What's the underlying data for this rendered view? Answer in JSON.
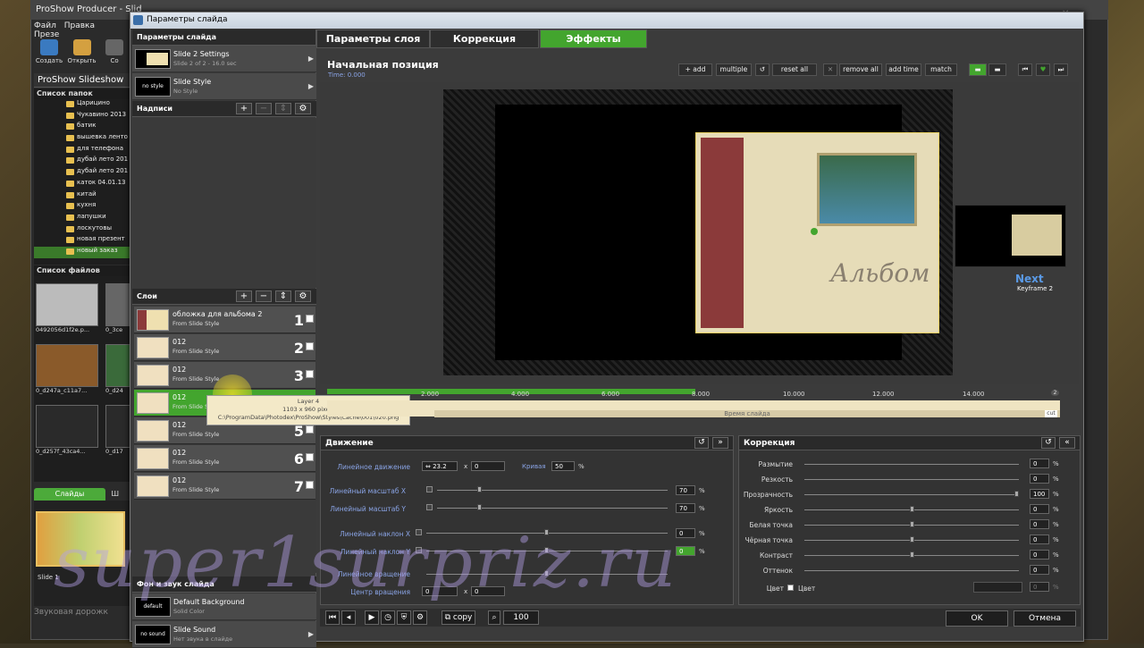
{
  "background_app": {
    "title": "ProShow Producer - Slid",
    "menu": [
      "Файл",
      "Правка",
      "Презе"
    ],
    "toolbar": [
      "Создать",
      "Открыть",
      "Со"
    ],
    "project": "ProShow Slideshow",
    "folders_header": "Список папок",
    "folders": [
      "Царицино",
      "Чукавино 2013",
      "батик",
      "вышевка ленто",
      "для телефона",
      "дубай лето 201",
      "дубай лето 201",
      "каток 04.01.13",
      "китай",
      "кухня",
      "лапушки",
      "лоскутовы",
      "новая презент",
      "новый заказ"
    ],
    "files_header": "Список файлов",
    "files": [
      "0492056d1f2e.p...",
      "0_3ce",
      "0_d247a_c11a7...",
      "0_d24",
      "0_d257f_43ca4...",
      "0_d17"
    ],
    "tab_slides": "Слайды",
    "tab_other": "Ш",
    "slide_label": "Slide 1",
    "audio_label": "Звуковая дорожк"
  },
  "dialog": {
    "title": "Параметры слайда",
    "left": {
      "header": "Параметры слайда",
      "slide_settings": {
        "title": "Slide 2 Settings",
        "sub": "Slide 2 of 2 - 16.0 sec"
      },
      "slide_style": {
        "thumb": "no style",
        "title": "Slide Style",
        "sub": "No Style"
      },
      "captions_header": "Надписи",
      "layers_header": "Слои",
      "layers": [
        {
          "name": "обложка для альбома 2",
          "sub": "From Slide Style",
          "num": "1"
        },
        {
          "name": "012",
          "sub": "From Slide Style",
          "num": "2"
        },
        {
          "name": "012",
          "sub": "From Slide Style",
          "num": "3"
        },
        {
          "name": "012",
          "sub": "From Slide Style",
          "num": "4"
        },
        {
          "name": "012",
          "sub": "From Slide Style",
          "num": "5"
        },
        {
          "name": "012",
          "sub": "From Slide Style",
          "num": "6"
        },
        {
          "name": "012",
          "sub": "From Slide Style",
          "num": "7"
        }
      ],
      "tooltip": {
        "line1": "Layer 4",
        "line2": "1103 x 960 pixels",
        "line3": "C:\\ProgramData\\Photodex\\ProShow\\Styles\\Cache\\001\\020.png"
      },
      "bg_sound_header": "Фон и звук слайда",
      "bg": {
        "thumb": "default",
        "title": "Default Background",
        "sub": "Solid Color"
      },
      "sound": {
        "thumb": "no sound",
        "title": "Slide Sound",
        "sub": "Нет звука в слайде"
      }
    },
    "tabs": [
      "Параметры слоя",
      "Коррекция",
      "Эффекты"
    ],
    "position_title": "Начальная позиция",
    "position_time": "Time: 0.000",
    "toolbar": {
      "add": "add",
      "multiple": "multiple",
      "reset_all": "reset all",
      "remove_all": "remove all",
      "add_time": "add time",
      "match": "match"
    },
    "next": {
      "label": "Next",
      "keyframe": "Keyframe 2"
    },
    "preview_text": "Альбом",
    "timeline": {
      "ticks": [
        "2.000",
        "4.000",
        "6.000",
        "8.000",
        "10.000",
        "12.000",
        "14.000"
      ],
      "label": "Время слайда",
      "end": "2",
      "cut": "cut"
    },
    "motion": {
      "header": "Движение",
      "rows": [
        {
          "label": "Линейное движение",
          "x": "23.2",
          "x_label": "x",
          "y": "0",
          "curve_label": "Кривая",
          "curve": "50",
          "curve_unit": "%"
        },
        {
          "label": "Линейный масштаб X",
          "value": "70",
          "unit": "%"
        },
        {
          "label": "Линейный масштаб Y",
          "value": "70",
          "unit": "%"
        },
        {
          "label": "Линейный наклон X",
          "value": "0",
          "unit": "%"
        },
        {
          "label": "Линейный наклон Y",
          "value": "0",
          "unit": "%"
        },
        {
          "label": "Линейное вращение"
        },
        {
          "label": "Центр вращения",
          "x": "0",
          "x_label": "x",
          "y": "0"
        }
      ]
    },
    "correction": {
      "header": "Коррекция",
      "rows": [
        {
          "label": "Размытие",
          "value": "0"
        },
        {
          "label": "Резкость",
          "value": "0"
        },
        {
          "label": "Прозрачность",
          "value": "100"
        },
        {
          "label": "Яркость",
          "value": "0"
        },
        {
          "label": "Белая точка",
          "value": "0"
        },
        {
          "label": "Чёрная точка",
          "value": "0"
        },
        {
          "label": "Контраст",
          "value": "0"
        },
        {
          "label": "Оттенок",
          "value": "0"
        }
      ],
      "color_label": "Цвет",
      "color_cb_label": "Цвет",
      "color_value": "0",
      "unit": "%"
    },
    "bottom": {
      "copy": "copy",
      "zoom": "100",
      "ok": "OK",
      "cancel": "Отмена"
    }
  },
  "watermark": "super1surpriz.ru",
  "colors": {
    "accent_green": "#43a52e",
    "label_blue": "#8aa4e6"
  }
}
